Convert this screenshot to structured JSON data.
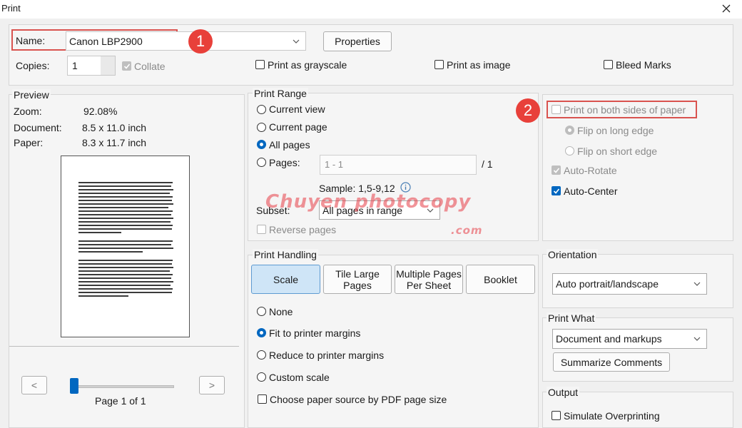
{
  "window": {
    "title": "Print"
  },
  "printer": {
    "name_label": "Name:",
    "name_value": "Canon LBP2900",
    "properties_label": "Properties",
    "copies_label": "Copies:",
    "copies_value": "1",
    "collate_label": "Collate",
    "grayscale_label": "Print as grayscale",
    "image_label": "Print as image",
    "bleed_label": "Bleed Marks"
  },
  "preview": {
    "legend": "Preview",
    "zoom_label": "Zoom:",
    "zoom_value": "92.08%",
    "document_label": "Document:",
    "document_value": "8.5 x 11.0 inch",
    "paper_label": "Paper:",
    "paper_value": "8.3 x 11.7 inch",
    "prev_label": "<",
    "next_label": ">",
    "page_indicator": "Page 1 of 1",
    "slider_fraction": 0.0
  },
  "print_range": {
    "legend": "Print Range",
    "current_view": "Current view",
    "current_page": "Current page",
    "all_pages": "All pages",
    "pages_label": "Pages:",
    "pages_value": "1 - 1",
    "pages_total": "/ 1",
    "sample": "Sample: 1,5-9,12",
    "subset_label": "Subset:",
    "subset_value": "All pages in range",
    "reverse_label": "Reverse pages"
  },
  "duplex": {
    "both_sides": "Print on both sides of paper",
    "flip_long": "Flip on long edge",
    "flip_short": "Flip on short edge",
    "auto_rotate": "Auto-Rotate",
    "auto_center": "Auto-Center"
  },
  "handling": {
    "legend": "Print Handling",
    "scale": "Scale",
    "tile_line1": "Tile Large",
    "tile_line2": "Pages",
    "multiple_line1": "Multiple Pages",
    "multiple_line2": "Per Sheet",
    "booklet": "Booklet",
    "none": "None",
    "fit": "Fit to printer margins",
    "reduce": "Reduce to printer margins",
    "custom": "Custom scale",
    "paper_source": "Choose paper source by PDF page size"
  },
  "orientation": {
    "legend": "Orientation",
    "value": "Auto portrait/landscape"
  },
  "print_what": {
    "legend": "Print What",
    "value": "Document and markups",
    "summarize": "Summarize Comments"
  },
  "output": {
    "legend": "Output",
    "simulate": "Simulate Overprinting"
  },
  "annotations": {
    "badge1": "1",
    "badge2": "2"
  },
  "watermark": {
    "line1": "Chuyen photocopy",
    "line2": ".com"
  },
  "colors": {
    "accent": "#0067c0",
    "highlight": "#d9534f",
    "scale_selected": "#cfe5f7"
  }
}
